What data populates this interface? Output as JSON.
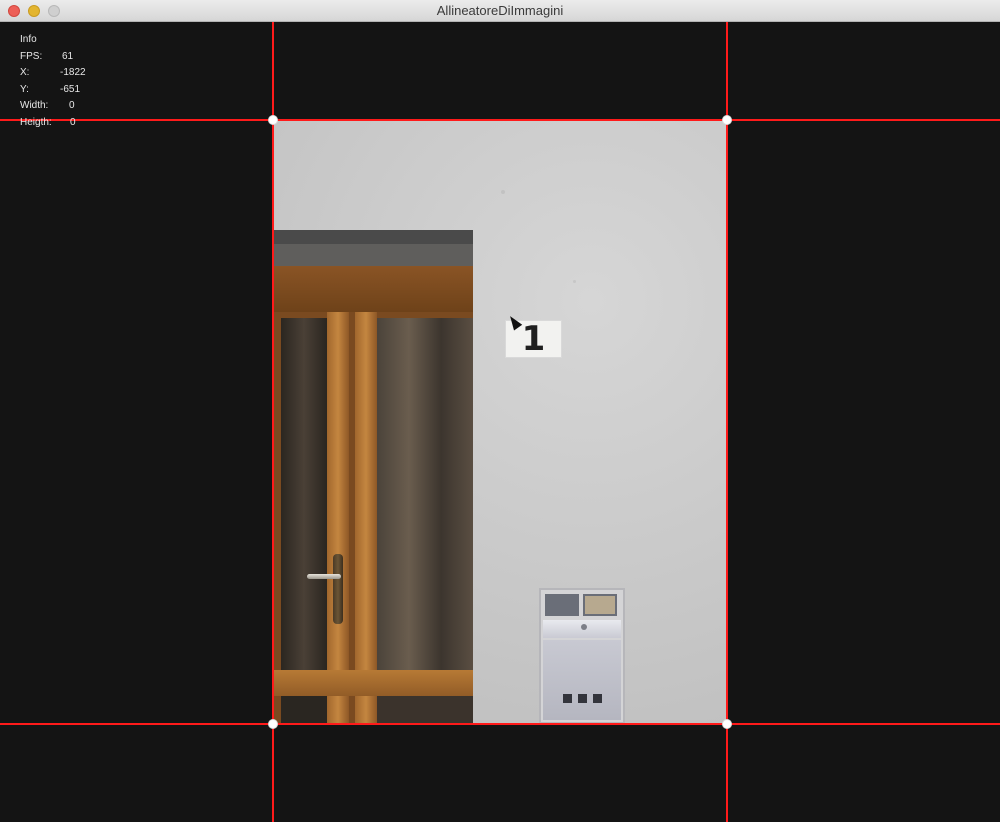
{
  "window": {
    "title": "AllineatoreDiImmagini",
    "buttons": [
      "close",
      "minimize",
      "zoom"
    ]
  },
  "info": {
    "heading": "Info",
    "rows": [
      {
        "label": "FPS:",
        "value": "61"
      },
      {
        "label": "X:",
        "value": "-1822"
      },
      {
        "label": "Y:",
        "value": "-651"
      },
      {
        "label": "Width:",
        "value": "0"
      },
      {
        "label": "Heigth:",
        "value": "0"
      }
    ]
  },
  "photo": {
    "house_number": "1"
  },
  "colors": {
    "background": "#141414",
    "guide_line": "#ff1a1a",
    "handle": "#ffffff",
    "text": "#e8e8e8"
  },
  "icons": {
    "close": "close-icon",
    "minimize": "minimize-icon",
    "zoom": "zoom-icon",
    "cursor": "mouse-pointer-icon"
  }
}
